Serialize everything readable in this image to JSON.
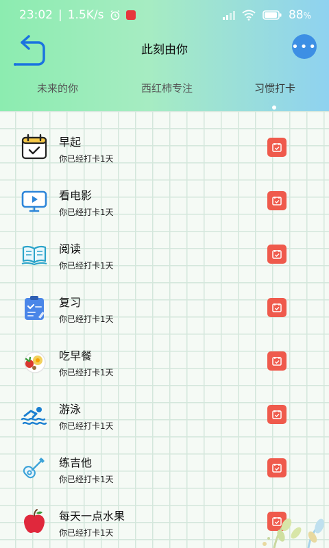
{
  "status_bar": {
    "time": "23:02",
    "speed": "1.5K/s",
    "battery": "88",
    "battery_unit": "%"
  },
  "header": {
    "title": "此刻由你"
  },
  "tabs": [
    {
      "label": "未来的你"
    },
    {
      "label": "西红柿专注"
    },
    {
      "label": "习惯打卡",
      "active": true
    }
  ],
  "habits": [
    {
      "name": "早起",
      "status": "你已经打卡1天",
      "icon": "calendar-check-icon"
    },
    {
      "name": "看电影",
      "status": "你已经打卡1天",
      "icon": "monitor-play-icon"
    },
    {
      "name": "阅读",
      "status": "你已经打卡1天",
      "icon": "open-book-icon"
    },
    {
      "name": "复习",
      "status": "你已经打卡1天",
      "icon": "clipboard-icon"
    },
    {
      "name": "吃早餐",
      "status": "你已经打卡1天",
      "icon": "breakfast-plate-icon"
    },
    {
      "name": "游泳",
      "status": "你已经打卡1天",
      "icon": "swimmer-icon"
    },
    {
      "name": "练吉他",
      "status": "你已经打卡1天",
      "icon": "guitar-icon"
    },
    {
      "name": "每天一点水果",
      "status": "你已经打卡1天",
      "icon": "apple-icon"
    }
  ],
  "colors": {
    "accent": "#3d8fe4",
    "checkin": "#ef5a4c",
    "grid": "#d4e7dc"
  }
}
